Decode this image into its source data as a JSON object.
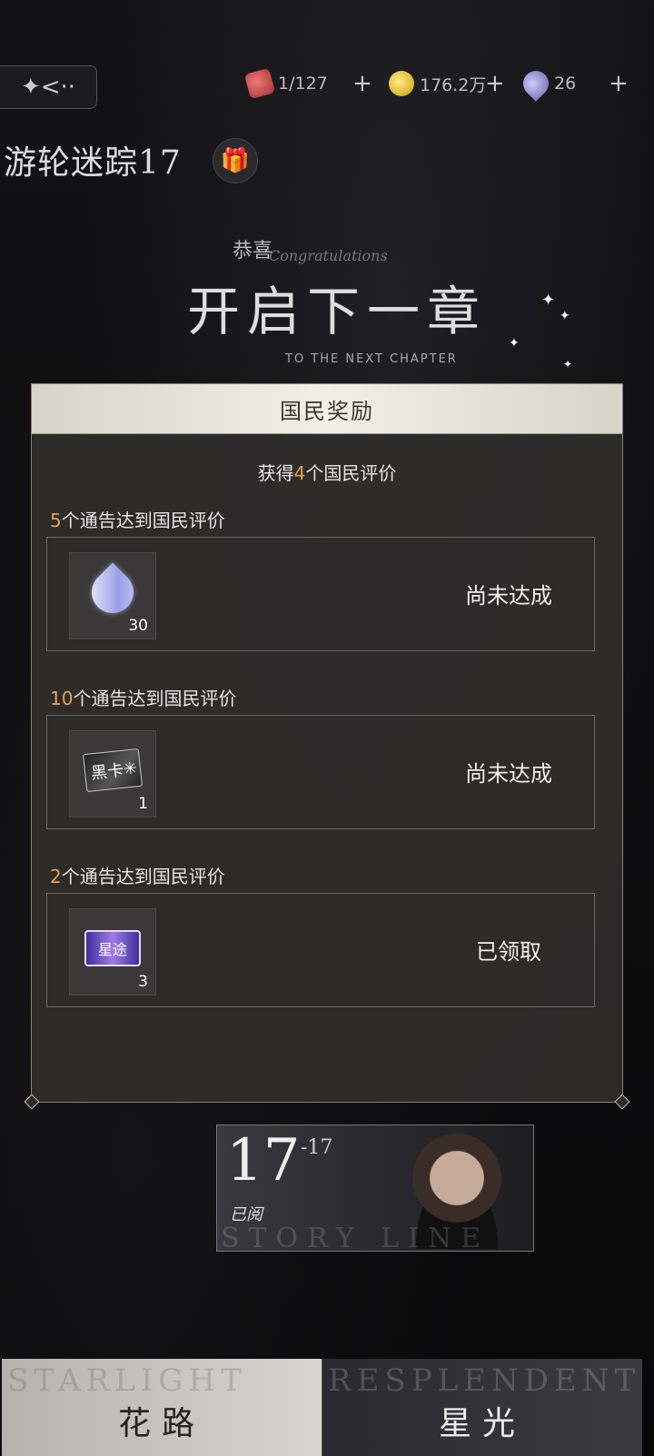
{
  "topbar": {
    "energy": "1/127",
    "gold": "176.2万",
    "gems": "26",
    "plus": "+"
  },
  "chapter": {
    "title": "游轮迷踪17"
  },
  "banner": {
    "congrats_cn": "恭喜",
    "congrats_en": "Congratulations",
    "headline": "开启下一章",
    "sub_en": "TO THE NEXT CHAPTER"
  },
  "modal": {
    "title": "国民奖励",
    "summary_prefix": "获得",
    "summary_count": "4",
    "summary_suffix": "个国民评价",
    "rewards": [
      {
        "count_required": "5",
        "condition": "个通告达到国民评价",
        "item_qty": "30",
        "item_icon": "gem-icon",
        "status": "尚未达成"
      },
      {
        "count_required": "10",
        "condition": "个通告达到国民评价",
        "item_qty": "1",
        "item_icon": "black-card-icon",
        "item_text": "黑卡",
        "status": "尚未达成"
      },
      {
        "count_required": "2",
        "condition": "个通告达到国民评价",
        "item_qty": "3",
        "item_icon": "star-ticket-icon",
        "item_text": "星途",
        "status": "已领取"
      }
    ]
  },
  "story_card": {
    "number": "17",
    "sub": "-17",
    "status": "已阅",
    "watermark": "STORY LINE"
  },
  "tabs": {
    "left_label": "花路",
    "left_bg": "STARLIGHT",
    "right_label": "星光",
    "right_bg": "RESPLENDENT"
  }
}
